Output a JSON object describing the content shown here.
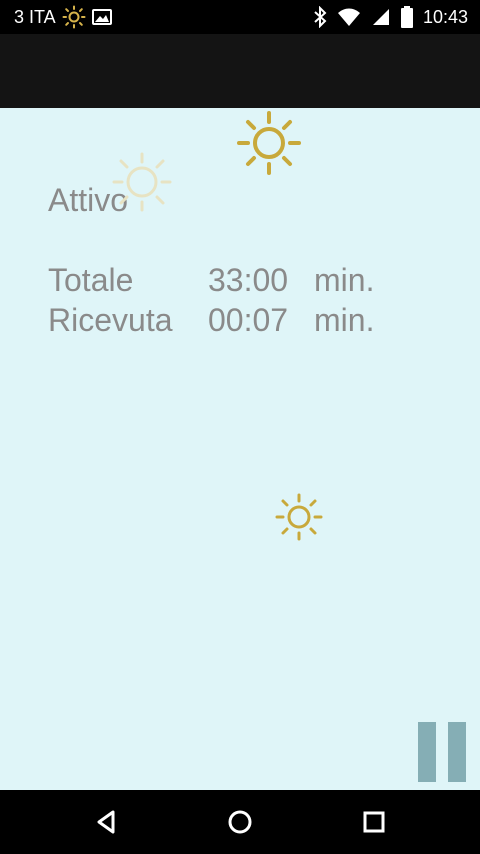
{
  "status_bar": {
    "carrier": "3 ITA",
    "time": "10:43",
    "icons": [
      "sun-icon",
      "image-icon",
      "bluetooth-icon",
      "wifi-icon",
      "signal-icon",
      "battery-icon"
    ]
  },
  "main": {
    "status_label": "Attivo",
    "stats": [
      {
        "label": "Totale",
        "value": "33:00",
        "unit": "min."
      },
      {
        "label": "Ricevuta",
        "value": "00:07",
        "unit": "min."
      }
    ]
  },
  "colors": {
    "background": "#dff5f8",
    "sun": "#c8a93b",
    "sun_faded": "#e7e3c3",
    "pause": "#85aeb5"
  },
  "controls": {
    "pause_icon": "pause-icon"
  },
  "navigation": {
    "buttons": [
      "back-icon",
      "home-icon",
      "recent-apps-icon"
    ]
  }
}
